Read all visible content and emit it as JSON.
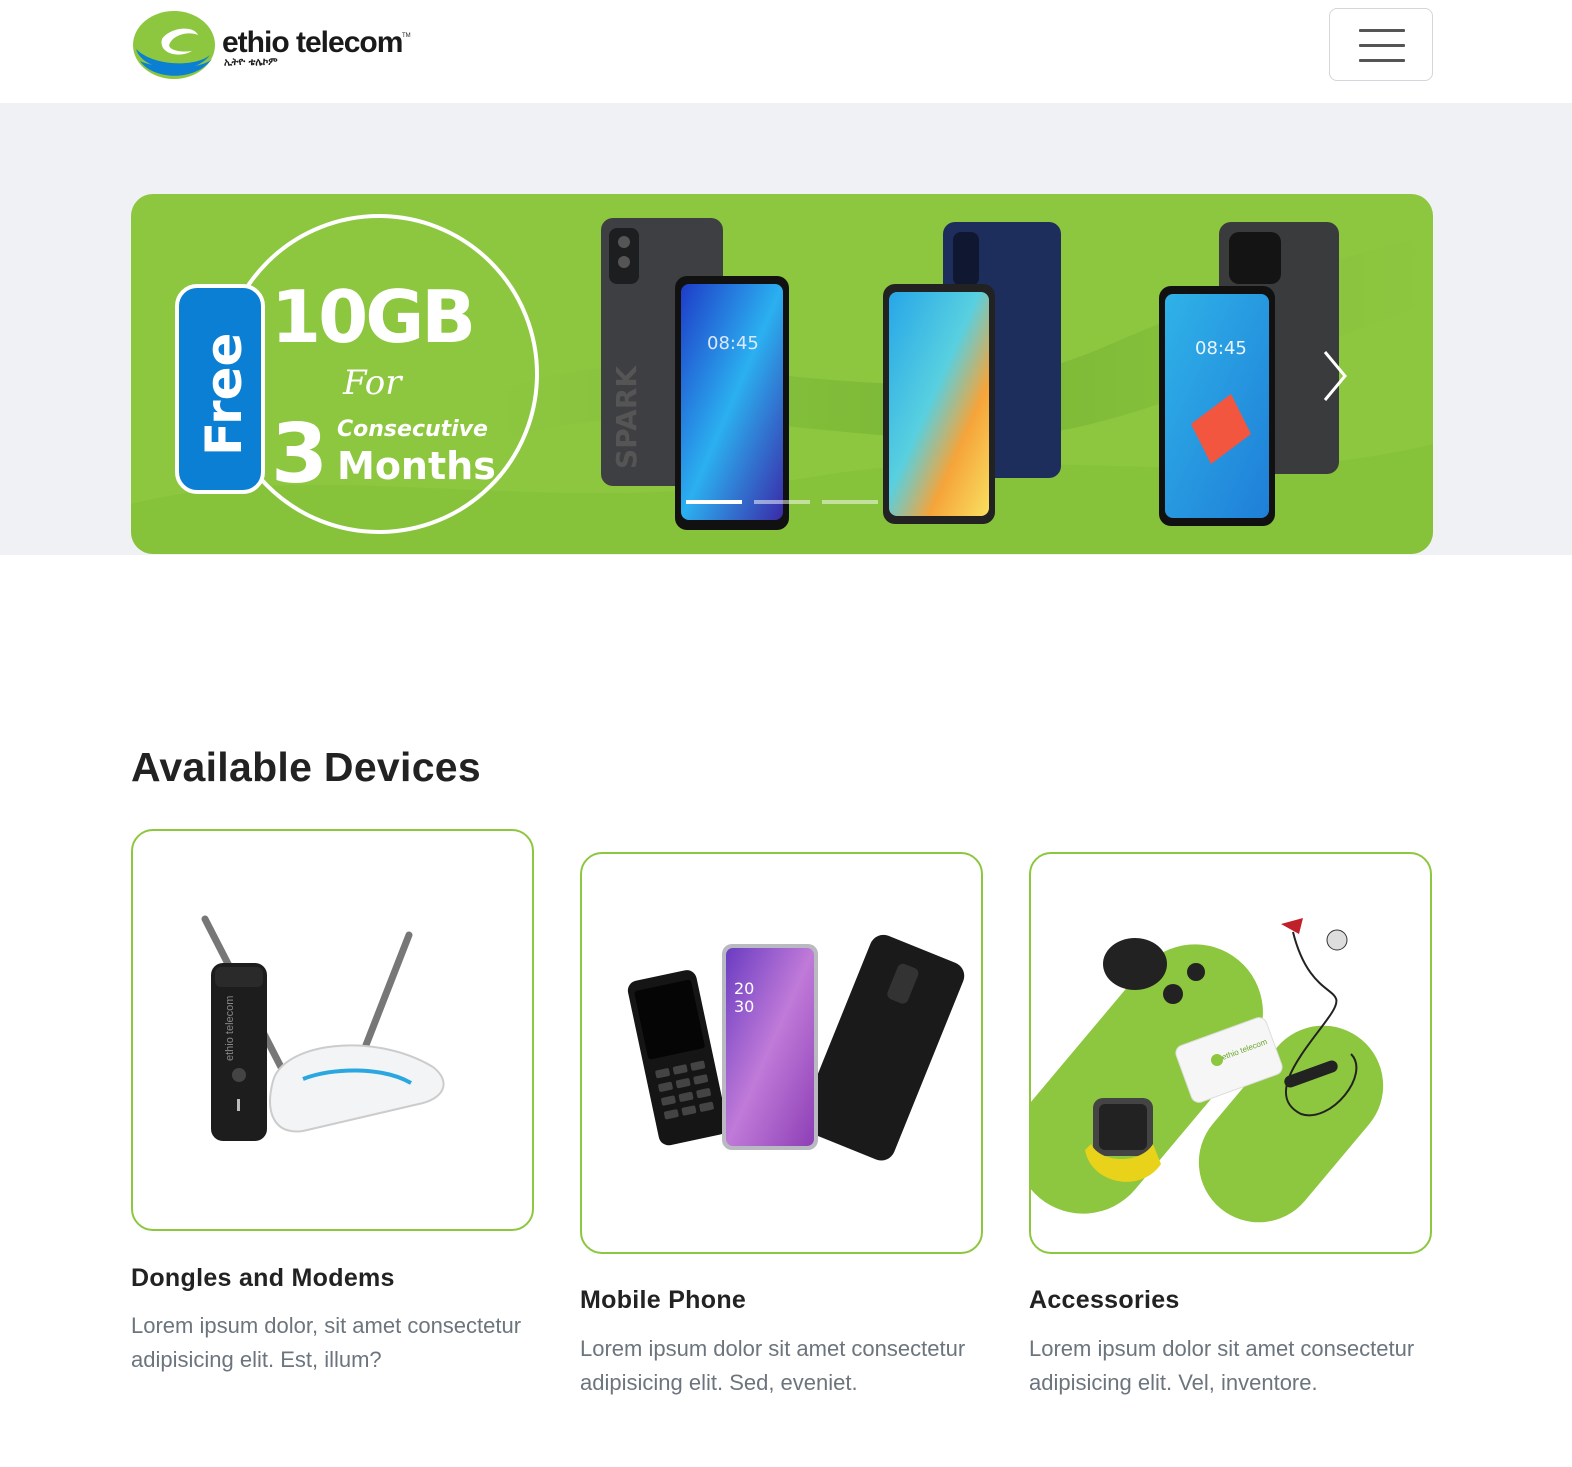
{
  "brand": {
    "name": "ethio telecom",
    "trademark": "TM",
    "subtitle": "ኢትዮ ቴሌኮም",
    "colors": {
      "green": "#8dc63f",
      "blue": "#0a7fd3",
      "dark": "#1a1a1a"
    }
  },
  "navbar": {
    "toggle_icon": "hamburger-icon"
  },
  "carousel": {
    "slide": {
      "badge": "Free",
      "amount": "10GB",
      "for_text": "For",
      "number": "3",
      "consecutive": "Consecutive",
      "months": "Months",
      "phone_times": [
        "08:45",
        "08:45"
      ],
      "phone_brand": "SPARK"
    },
    "slide_count": 3,
    "active_index": 0,
    "next_icon": "chevron-right-icon"
  },
  "devices": {
    "title": "Available Devices",
    "cards": [
      {
        "title": "Dongles and Modems",
        "text": "Lorem ipsum dolor, sit amet consectetur adipisicing elit. Est, illum?",
        "image_brand": "ethio telecom"
      },
      {
        "title": "Mobile Phone",
        "text": "Lorem ipsum dolor sit amet consectetur adipisicing elit. Sed, eveniet.",
        "screen_time_hour": "20",
        "screen_time_min": "30"
      },
      {
        "title": "Accessories",
        "text": "Lorem ipsum dolor sit amet consectetur adipisicing elit. Vel, inventore.",
        "image_brand": "ethio telecom"
      }
    ]
  }
}
